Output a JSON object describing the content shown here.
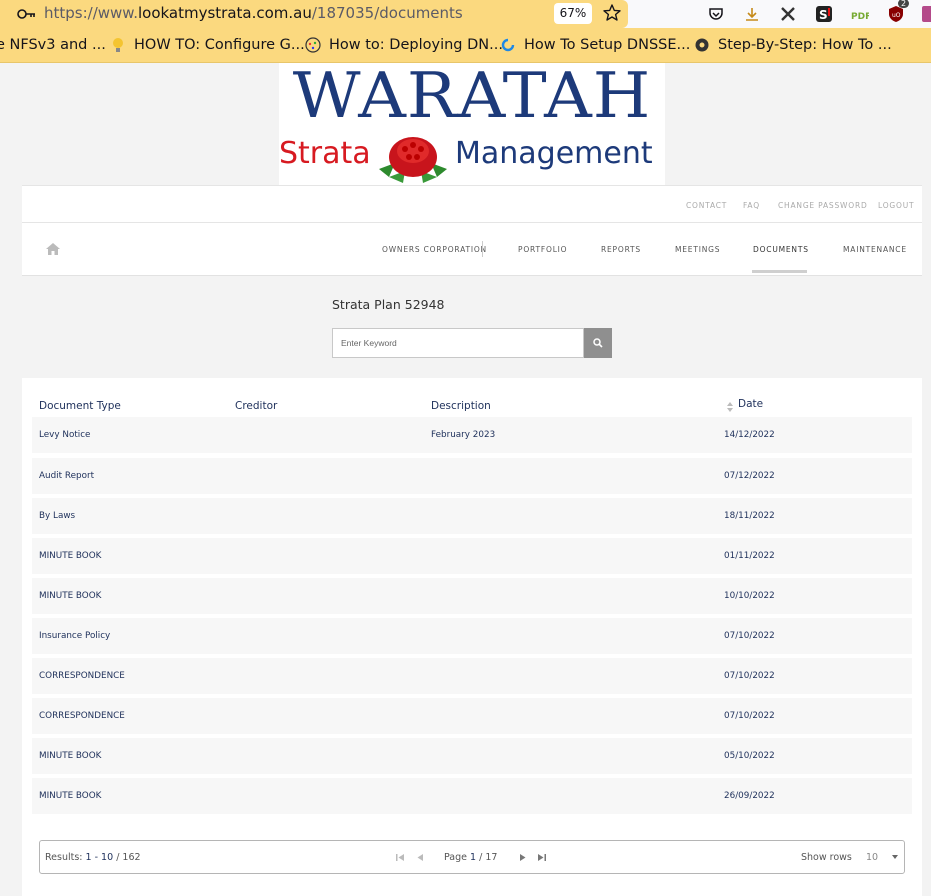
{
  "browser": {
    "url_prefix": "https://www.",
    "url_domain": "lookatmystrata.com.au",
    "url_path": "/187035/documents",
    "zoom": "67%",
    "bookmarks": [
      {
        "label": "e NFSv3 and ...",
        "icon": "none"
      },
      {
        "label": "HOW TO: Configure G...",
        "icon": "lightbulb-icon"
      },
      {
        "label": "How to: Deploying DN...",
        "icon": "globe-icon"
      },
      {
        "label": "How To Setup DNSSE...",
        "icon": "refresh-icon"
      },
      {
        "label": "Step-By-Step: How To ...",
        "icon": "gear-icon"
      }
    ],
    "extension_badge": "2"
  },
  "logo": {
    "top": "WARATAH",
    "left": "Strata",
    "right": "Management"
  },
  "topnav": {
    "contact": "CONTACT",
    "faq": "FAQ",
    "change_password": "CHANGE PASSWORD",
    "logout": "LOGOUT"
  },
  "mainnav": {
    "owners": "OWNERS CORPORATION",
    "portfolio": "PORTFOLIO",
    "reports": "REPORTS",
    "meetings": "MEETINGS",
    "documents": "DOCUMENTS",
    "maintenance": "MAINTENANCE"
  },
  "plan_title": "Strata Plan 52948",
  "search": {
    "placeholder": "Enter Keyword"
  },
  "table": {
    "headers": {
      "type": "Document Type",
      "creditor": "Creditor",
      "description": "Description",
      "date": "Date"
    },
    "rows": [
      {
        "type": "Levy Notice",
        "creditor": "",
        "description": "February 2023",
        "date": "14/12/2022"
      },
      {
        "type": "Audit Report",
        "creditor": "",
        "description": "",
        "date": "07/12/2022"
      },
      {
        "type": "By Laws",
        "creditor": "",
        "description": "",
        "date": "18/11/2022"
      },
      {
        "type": "MINUTE BOOK",
        "creditor": "",
        "description": "",
        "date": "01/11/2022"
      },
      {
        "type": "MINUTE BOOK",
        "creditor": "",
        "description": "",
        "date": "10/10/2022"
      },
      {
        "type": "Insurance Policy",
        "creditor": "",
        "description": "",
        "date": "07/10/2022"
      },
      {
        "type": "CORRESPONDENCE",
        "creditor": "",
        "description": "",
        "date": "07/10/2022"
      },
      {
        "type": "CORRESPONDENCE",
        "creditor": "",
        "description": "",
        "date": "07/10/2022"
      },
      {
        "type": "MINUTE BOOK",
        "creditor": "",
        "description": "",
        "date": "05/10/2022"
      },
      {
        "type": "MINUTE BOOK",
        "creditor": "",
        "description": "",
        "date": "26/09/2022"
      }
    ]
  },
  "pager": {
    "results_label": "Results:",
    "results_range": "1 - 10",
    "results_total": "/ 162",
    "page_label": "Page",
    "page_current": "1",
    "page_total": "/ 17",
    "show_rows_label": "Show rows",
    "show_rows_value": "10"
  }
}
